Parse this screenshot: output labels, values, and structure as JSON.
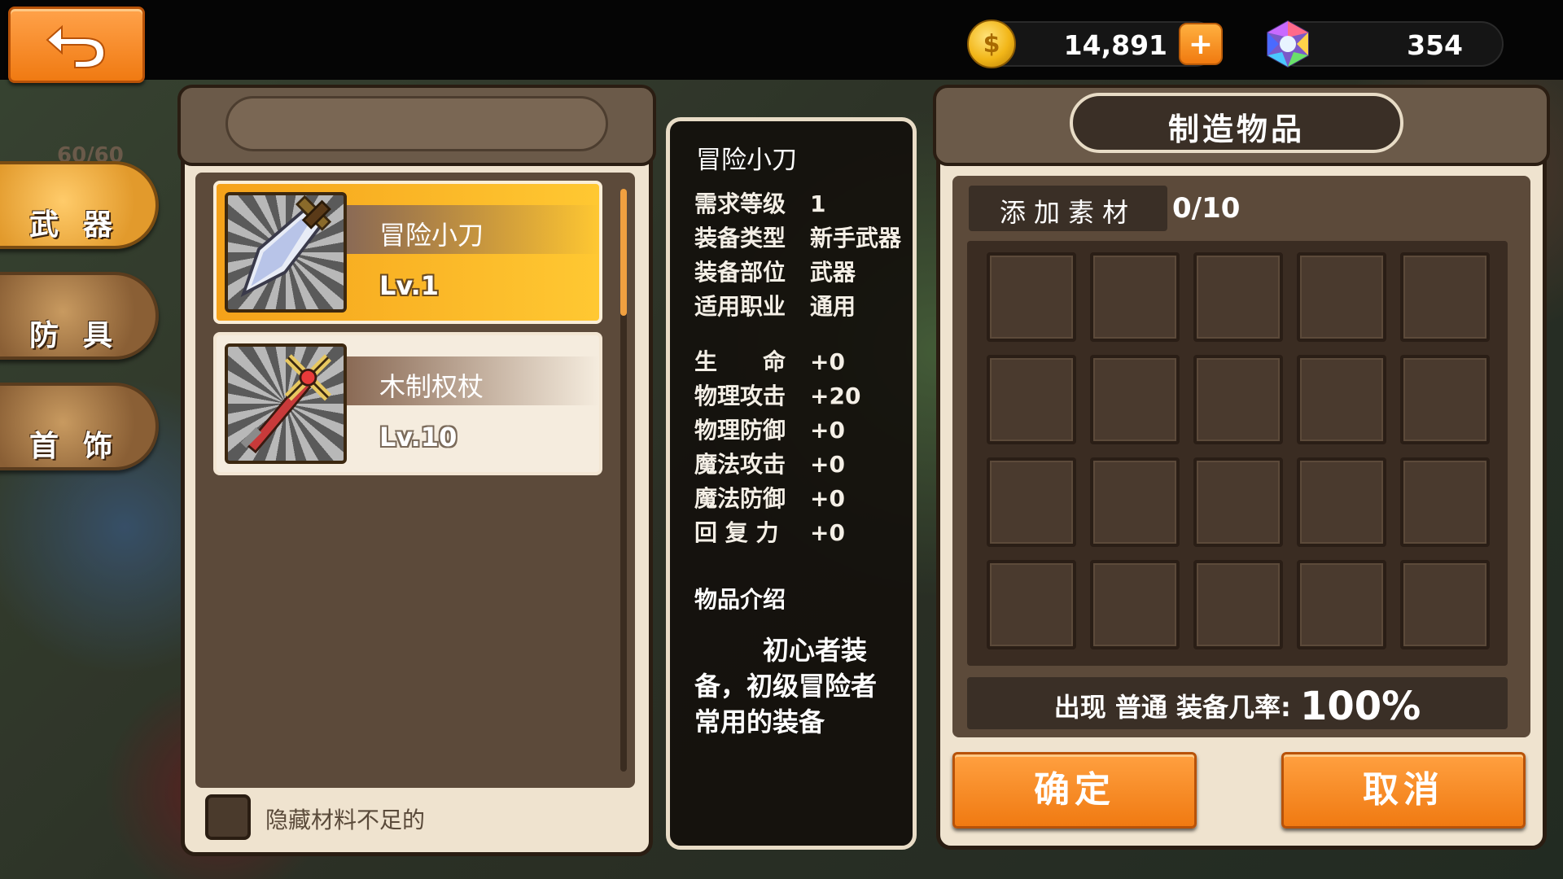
{
  "currency": {
    "gold": "14,891",
    "gold_icon_char": "$",
    "plus_label": "+",
    "gems": "354"
  },
  "sidebar": {
    "caption": "60/60",
    "tabs": [
      {
        "label": "武器",
        "active": true
      },
      {
        "label": "防具",
        "active": false
      },
      {
        "label": "首饰",
        "active": false
      }
    ]
  },
  "item_list": {
    "items": [
      {
        "name": "冒险小刀",
        "level": "Lv.1",
        "selected": true,
        "icon": "dagger-icon"
      },
      {
        "name": "木制权杖",
        "level": "Lv.10",
        "selected": false,
        "icon": "scepter-icon"
      }
    ],
    "hide_insufficient_label": "隐藏材料不足的"
  },
  "detail": {
    "title": "冒险小刀",
    "info": [
      {
        "key": "需求等级",
        "value": "1"
      },
      {
        "key": "装备类型",
        "value": "新手武器"
      },
      {
        "key": "装备部位",
        "value": "武器"
      },
      {
        "key": "适用职业",
        "value": "通用"
      }
    ],
    "stats": [
      {
        "key": "生　　命",
        "value": "+0"
      },
      {
        "key": "物理攻击",
        "value": "+20"
      },
      {
        "key": "物理防御",
        "value": "+0"
      },
      {
        "key": "魔法攻击",
        "value": "+0"
      },
      {
        "key": "魔法防御",
        "value": "+0"
      },
      {
        "key": "回 复 力",
        "value": "+0"
      }
    ],
    "desc_label": "物品介绍",
    "desc_text": "初心者装备，初级冒险者常用的装备"
  },
  "craft": {
    "title": "制造物品",
    "add_material_label": "添加素材",
    "material_count": "0/10",
    "slots": 20,
    "rate_prefix": "出现  普通  装备几率:",
    "rate_value": "100%",
    "confirm_label": "确定",
    "cancel_label": "取消"
  }
}
